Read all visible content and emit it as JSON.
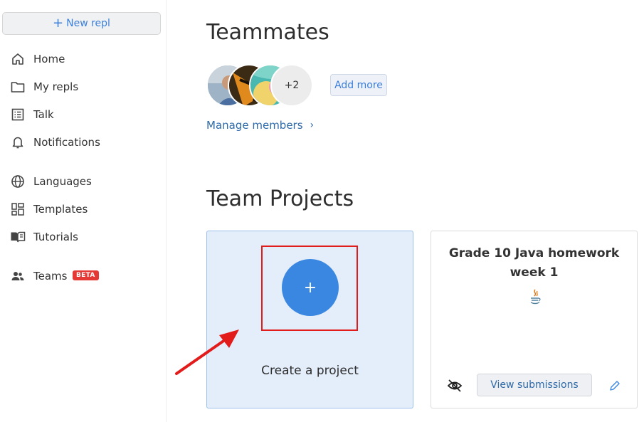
{
  "sidebar": {
    "new_repl": "New repl",
    "items": [
      {
        "label": "Home",
        "icon": "home-icon"
      },
      {
        "label": "My repls",
        "icon": "folder-icon"
      },
      {
        "label": "Talk",
        "icon": "list-icon"
      },
      {
        "label": "Notifications",
        "icon": "bell-icon"
      },
      {
        "label": "Languages",
        "icon": "globe-icon"
      },
      {
        "label": "Templates",
        "icon": "templates-icon"
      },
      {
        "label": "Tutorials",
        "icon": "book-icon"
      },
      {
        "label": "Teams",
        "icon": "team-icon",
        "badge": "BETA"
      }
    ]
  },
  "teammates": {
    "title": "Teammates",
    "more_count": "+2",
    "add_more": "Add more",
    "manage_members": "Manage members"
  },
  "projects": {
    "title": "Team Projects",
    "create_label": "Create a project",
    "create_icon": "+",
    "cards": [
      {
        "title": "Grade 10 Java homework week 1",
        "view_submissions": "View submissions"
      }
    ]
  },
  "colors": {
    "accent": "#3a87e1",
    "highlight": "#e21b1b",
    "badge": "#e53935"
  }
}
